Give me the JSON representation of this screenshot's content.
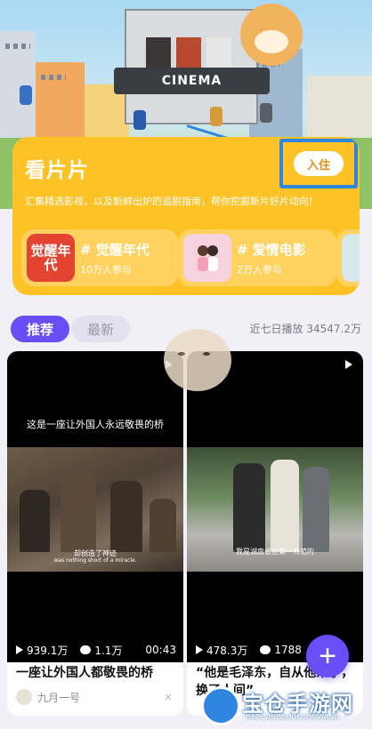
{
  "hero": {
    "cinema_sign": "CINEMA"
  },
  "card": {
    "title": "看片片",
    "join_button": "入住",
    "description": "汇集精选影视，以及新鲜出炉的追剧指南，帮你挖掘新片好片动向!",
    "topics": [
      {
        "thumb_text": "觉醒年代",
        "name": "# 觉醒年代",
        "count": "10万人参与"
      },
      {
        "name": "# 爱情电影",
        "count": "2万人参与"
      }
    ]
  },
  "tabs": [
    {
      "label": "推荐"
    },
    {
      "label": "最新"
    }
  ],
  "play_stats": "近七日播放 34547.2万",
  "videos": [
    {
      "top_caption": "这是一座让外国人永远敬畏的桥",
      "subtitle_cn": "却创造了神迹",
      "subtitle_en": "was nothing short of a miracle.",
      "views": "939.1万",
      "comments": "1.1万",
      "duration": "00:43",
      "title": "一座让外国人都敬畏的桥",
      "author": "九月一号",
      "dismiss": "×"
    },
    {
      "subtitle_cn": "我是湖南省立第一师范的",
      "views": "478.3万",
      "comments": "1788",
      "title": "“他是毛泽东，自从他来了，换了人间”"
    }
  ],
  "fab": {
    "label": "+"
  },
  "watermark": {
    "name": "宝仓手游网",
    "domain": "BAOCANGSHOUYOUWANG"
  }
}
